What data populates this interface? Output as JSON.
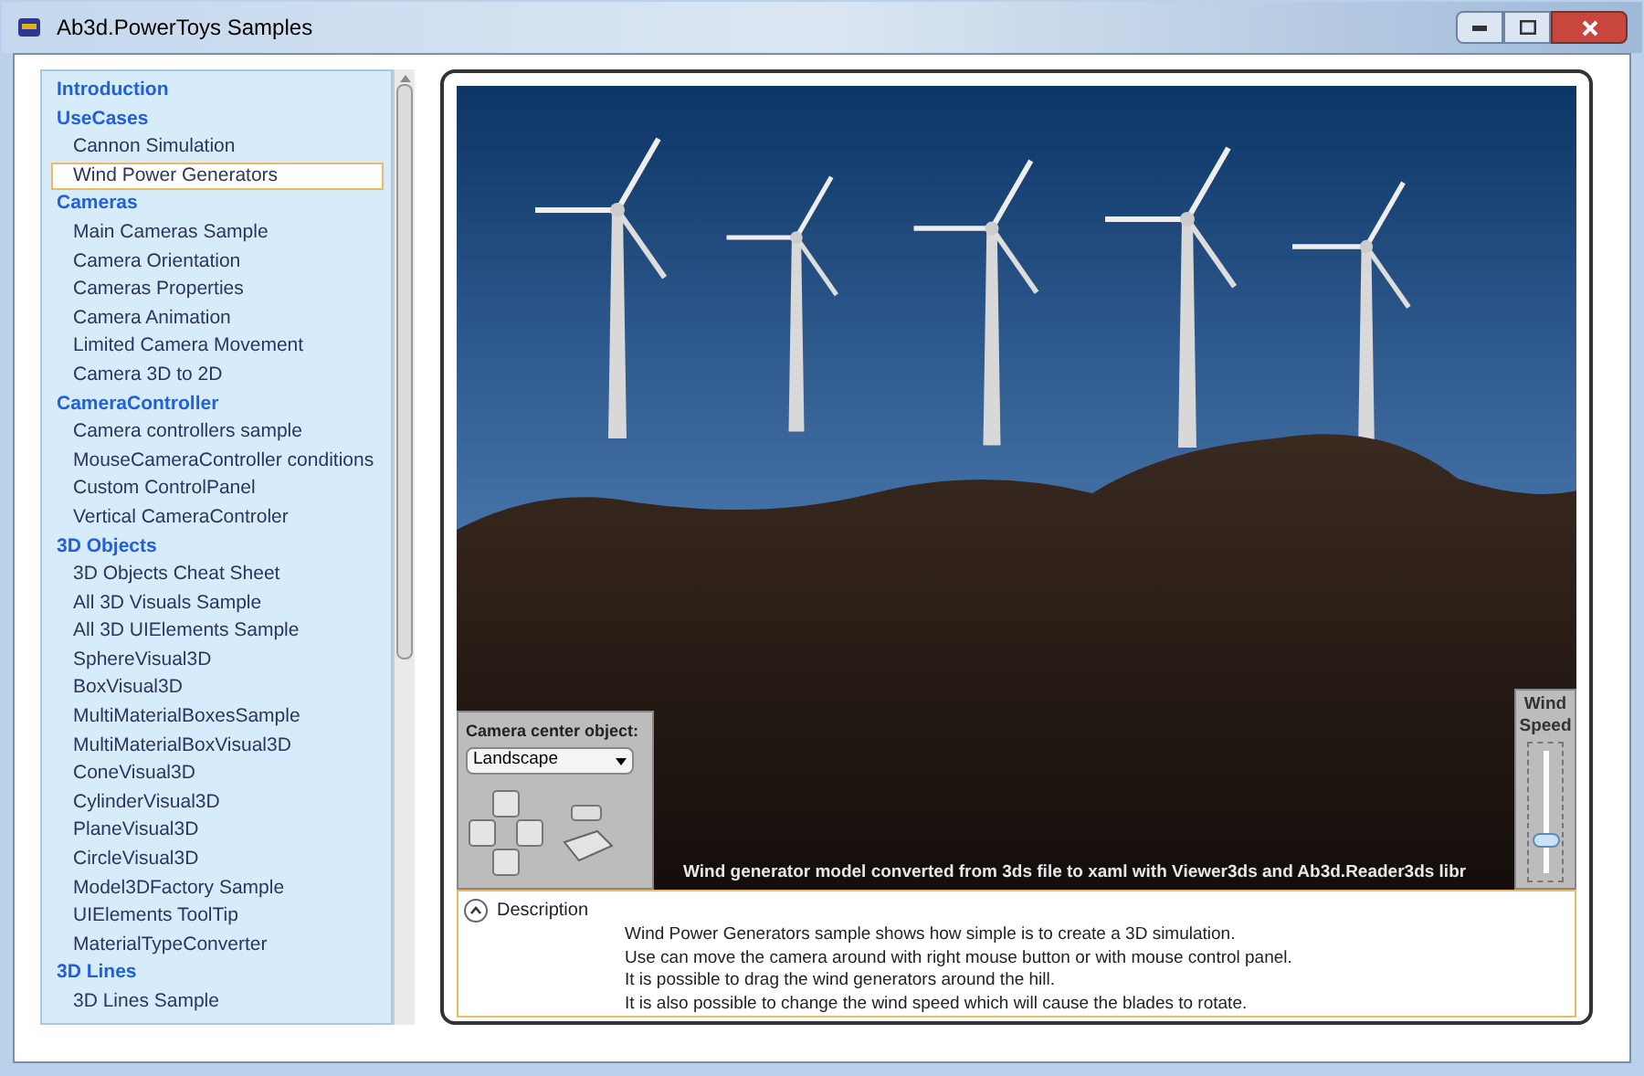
{
  "window": {
    "title": "Ab3d.PowerToys Samples"
  },
  "sidebar": {
    "groups": [
      {
        "label": "Introduction"
      },
      {
        "label": "UseCases",
        "children": [
          {
            "label": "Cannon Simulation",
            "selected": false
          },
          {
            "label": "Wind Power Generators",
            "selected": true
          }
        ]
      },
      {
        "label": "Cameras",
        "children": [
          {
            "label": "Main Cameras Sample",
            "selected": false
          },
          {
            "label": "Camera Orientation",
            "selected": false
          },
          {
            "label": "Cameras Properties",
            "selected": false
          },
          {
            "label": "Camera Animation",
            "selected": false
          },
          {
            "label": "Limited Camera Movement",
            "selected": false
          },
          {
            "label": "Camera 3D to 2D",
            "selected": false
          }
        ]
      },
      {
        "label": "CameraController",
        "children": [
          {
            "label": "Camera controllers sample",
            "selected": false
          },
          {
            "label": "MouseCameraController conditions",
            "selected": false
          },
          {
            "label": "Custom ControlPanel",
            "selected": false
          },
          {
            "label": "Vertical CameraControler",
            "selected": false
          }
        ]
      },
      {
        "label": "3D Objects",
        "children": [
          {
            "label": "3D Objects Cheat Sheet",
            "selected": false
          },
          {
            "label": "All 3D Visuals Sample",
            "selected": false
          },
          {
            "label": "All 3D UIElements Sample",
            "selected": false
          },
          {
            "label": "SphereVisual3D",
            "selected": false
          },
          {
            "label": "BoxVisual3D",
            "selected": false
          },
          {
            "label": "MultiMaterialBoxesSample",
            "selected": false
          },
          {
            "label": "MultiMaterialBoxVisual3D",
            "selected": false
          },
          {
            "label": "ConeVisual3D",
            "selected": false
          },
          {
            "label": "CylinderVisual3D",
            "selected": false
          },
          {
            "label": "PlaneVisual3D",
            "selected": false
          },
          {
            "label": "CircleVisual3D",
            "selected": false
          },
          {
            "label": "Model3DFactory Sample",
            "selected": false
          },
          {
            "label": "UIElements ToolTip",
            "selected": false
          },
          {
            "label": "MaterialTypeConverter",
            "selected": false
          }
        ]
      },
      {
        "label": "3D Lines",
        "children": [
          {
            "label": "3D Lines Sample",
            "selected": false
          }
        ]
      }
    ]
  },
  "viewport": {
    "camera_panel": {
      "label": "Camera center object:",
      "dropdown_value": "Landscape"
    },
    "caption": "Wind generator model converted from 3ds file to xaml with Viewer3ds and Ab3d.Reader3ds libr",
    "wind_speed": {
      "label_lines": [
        "Wind",
        "Speed"
      ],
      "level": 0.3
    }
  },
  "description": {
    "title": "Description",
    "expanded": true,
    "lines": [
      "Wind Power Generators sample shows how simple is to create a 3D simulation.",
      "Use can move the camera around with right mouse button or with mouse control panel.",
      "It is possible to drag the wind generators around the hill.",
      "It is also possible to change the wind speed which will cause the blades to rotate."
    ]
  }
}
